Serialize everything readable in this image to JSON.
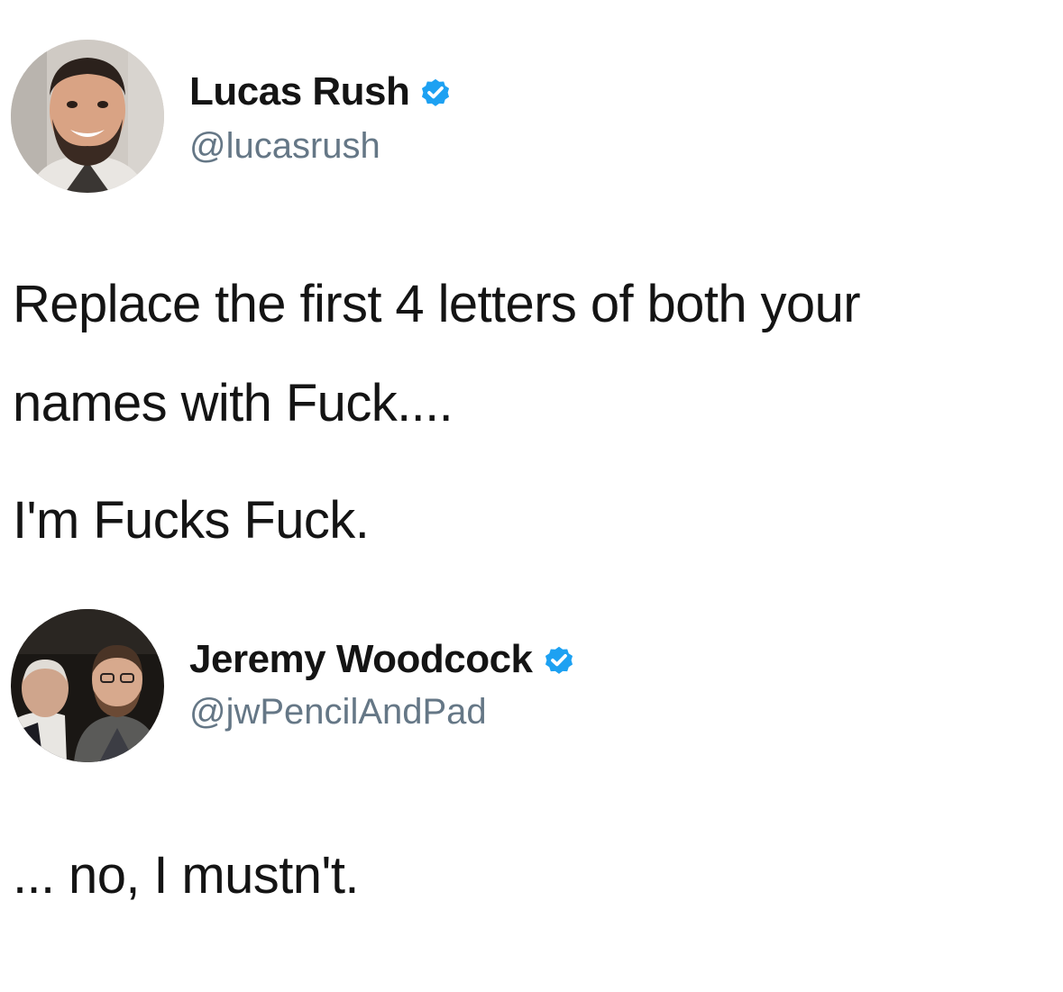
{
  "tweets": [
    {
      "display_name": "Lucas Rush",
      "handle": "@lucasrush",
      "verified": true,
      "avatar_icon": "profile-photo-man-beard",
      "text_lines": [
        "Replace the first 4 letters of both your",
        "names with Fuck....",
        "I'm Fucks Fuck."
      ]
    },
    {
      "display_name": "Jeremy Woodcock",
      "handle": "@jwPencilAndPad",
      "verified": true,
      "avatar_icon": "profile-photo-two-men",
      "text_lines": [
        "... no, I mustn't."
      ]
    }
  ],
  "colors": {
    "verified_badge": "#1DA1F2",
    "handle_gray": "#657786",
    "text": "#141414",
    "background": "#FFFFFF"
  }
}
